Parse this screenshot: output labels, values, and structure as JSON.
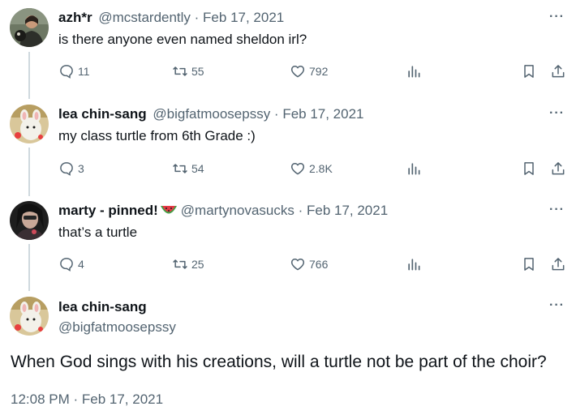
{
  "tweets": [
    {
      "display_name": "azh*r",
      "handle": "@mcstardently",
      "date": "Feb 17, 2021",
      "text": "is there anyone even named sheldon irl?",
      "replies": "11",
      "retweets": "55",
      "likes": "792"
    },
    {
      "display_name": "lea chin-sang",
      "handle": "@bigfatmoosepssy",
      "date": "Feb 17, 2021",
      "text": "my class turtle from 6th Grade :)",
      "replies": "3",
      "retweets": "54",
      "likes": "2.8K"
    },
    {
      "display_name": "marty - pinned!",
      "handle": "@martynovasucks",
      "date": "Feb 17, 2021",
      "text": "that’s a turtle",
      "replies": "4",
      "retweets": "25",
      "likes": "766"
    }
  ],
  "main_tweet": {
    "display_name": "lea chin-sang",
    "handle": "@bigfatmoosepssy",
    "text": "When God sings with his creations, will a turtle not be part of the choir?",
    "timestamp": "12:08 PM · Feb 17, 2021"
  },
  "separator": " · ",
  "more_label": "···",
  "icons": {
    "reply": "speech-bubble-icon",
    "retweet": "retweet-arrows-icon",
    "like": "heart-icon",
    "views": "bar-chart-icon",
    "bookmark": "bookmark-icon",
    "share": "share-upload-icon",
    "name_emoji": "watermelon-emoji"
  },
  "colors": {
    "text": "#0f1419",
    "secondary": "#536471",
    "thread_line": "#cfd9de"
  }
}
